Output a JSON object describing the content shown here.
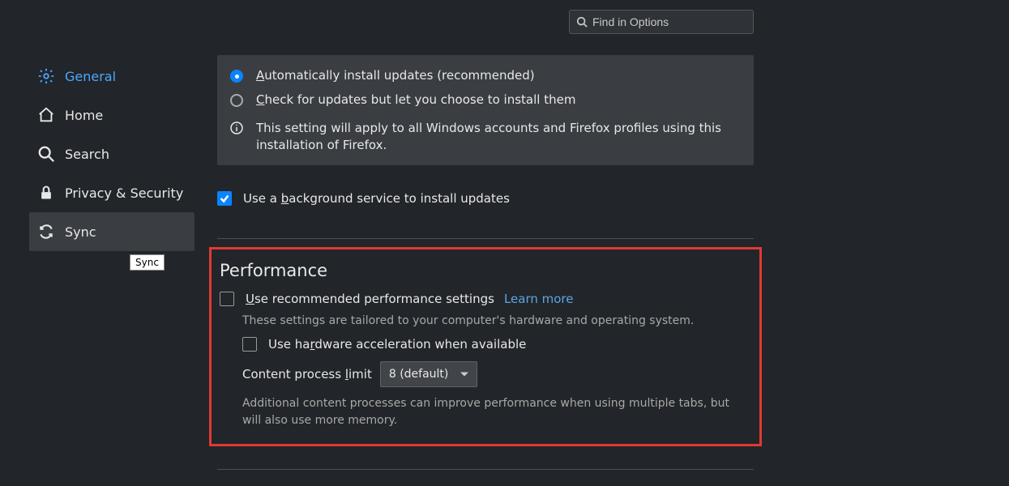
{
  "search": {
    "placeholder": "Find in Options"
  },
  "sidebar": {
    "items": [
      {
        "label": "General"
      },
      {
        "label": "Home"
      },
      {
        "label": "Search"
      },
      {
        "label": "Privacy & Security"
      },
      {
        "label": "Sync"
      }
    ],
    "tooltip": "Sync"
  },
  "updates": {
    "radio1_prefix": "A",
    "radio1_rest": "utomatically install updates (recommended)",
    "radio2_prefix": "C",
    "radio2_rest": "heck for updates but let you choose to install them",
    "info_text": "This setting will apply to all Windows accounts and Firefox profiles using this installation of Firefox.",
    "bg_service_pre": "Use a ",
    "bg_service_u": "b",
    "bg_service_post": "ackground service to install updates"
  },
  "performance": {
    "title": "Performance",
    "recommended_pre": "U",
    "recommended_post": "se recommended performance settings",
    "learn_more": "Learn more",
    "desc": "These settings are tailored to your computer's hardware and operating system.",
    "hw_pre": "Use ha",
    "hw_u": "r",
    "hw_post": "dware acceleration when available",
    "limit_pre": "Content process ",
    "limit_u": "l",
    "limit_post": "imit",
    "limit_value": "8 (default)",
    "note": "Additional content processes can improve performance when using multiple tabs, but will also use more memory."
  }
}
